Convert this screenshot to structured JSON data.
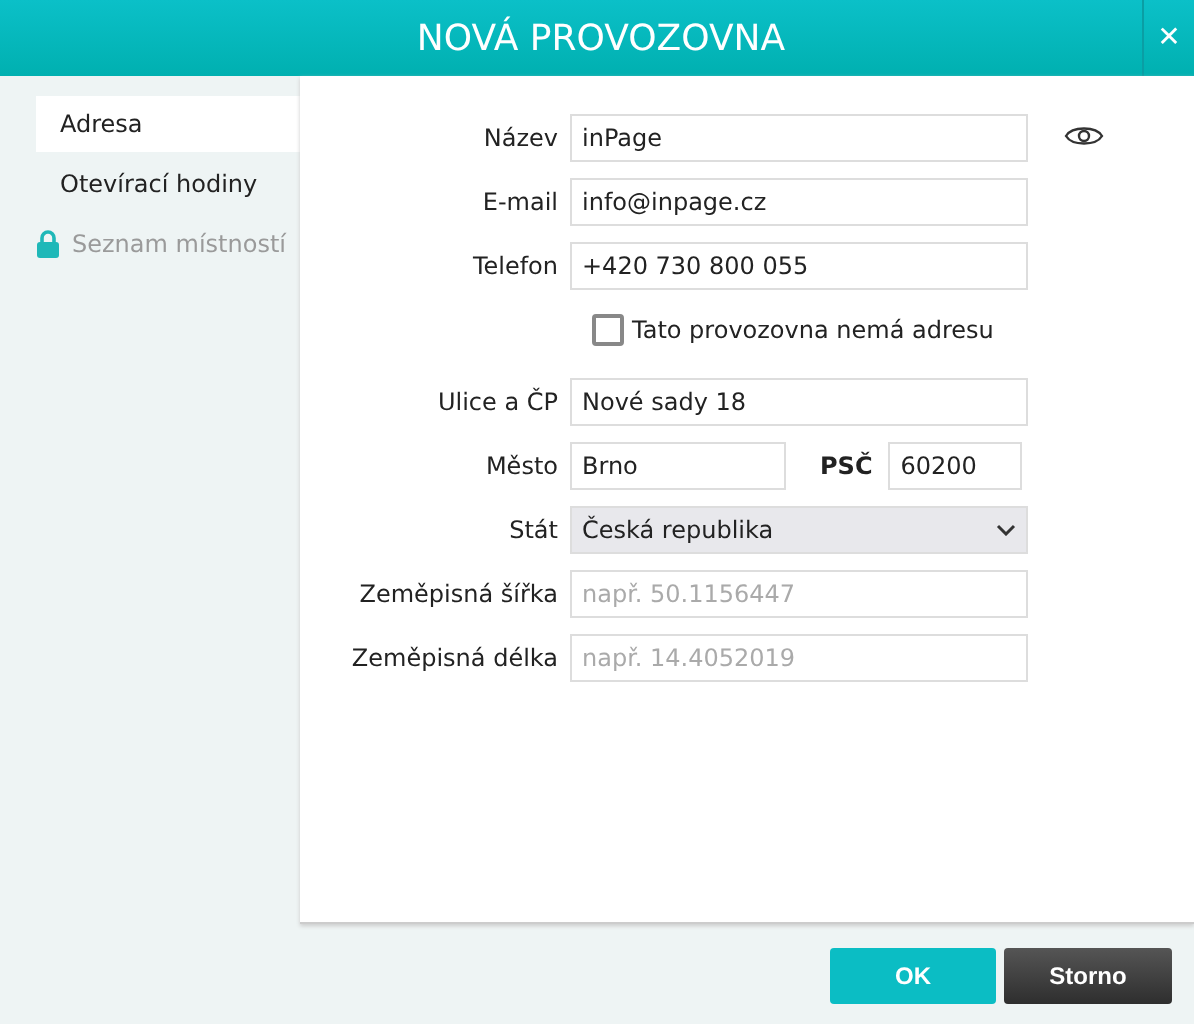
{
  "window": {
    "title": "NOVÁ PROVOZOVNA",
    "close": "✕"
  },
  "sidebar": {
    "items": [
      {
        "label": "Adresa",
        "selected": true,
        "disabled": false
      },
      {
        "label": "Otevírací hodiny",
        "selected": false,
        "disabled": false
      },
      {
        "label": "Seznam místností",
        "selected": false,
        "disabled": true
      }
    ]
  },
  "form": {
    "rows": [
      {
        "kind": "text",
        "label": "Název",
        "value": "inPage"
      },
      {
        "kind": "text",
        "label": "E-mail",
        "value": "info@inpage.cz"
      },
      {
        "kind": "text",
        "label": "Telefon",
        "value": "+420 730 800 055"
      },
      {
        "kind": "checkbox",
        "label": "Tato provozovna nemá adresu",
        "checked": false
      },
      {
        "kind": "text",
        "label": "Ulice a ČP",
        "value": "Nové sady 18"
      },
      {
        "kind": "pair",
        "label": "Město",
        "value": "Brno",
        "label_2": "PSČ",
        "value_2": "60200"
      },
      {
        "kind": "select",
        "label": "Stát",
        "value": "Česká republika"
      },
      {
        "kind": "text",
        "label": "Zeměpisná šířka",
        "placeholder": "např. 50.1156447"
      },
      {
        "kind": "text",
        "label": "Zeměpisná délka",
        "placeholder": "např. 14.4052019"
      }
    ]
  },
  "buttons": [
    {
      "label": "OK",
      "kind": "primary"
    },
    {
      "label": "Storno",
      "kind": "secondary"
    }
  ]
}
